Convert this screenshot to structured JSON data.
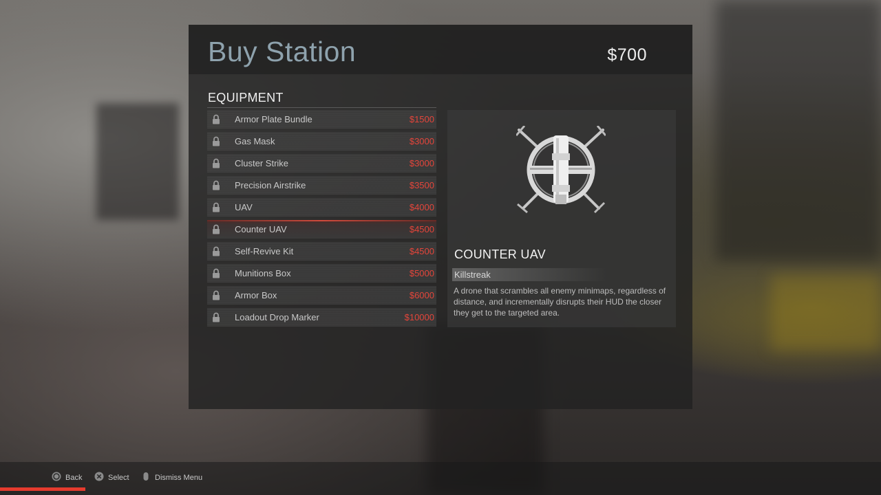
{
  "header": {
    "title": "Buy Station",
    "money": "$700"
  },
  "section": {
    "title": "EQUIPMENT"
  },
  "items": [
    {
      "name": "Armor Plate Bundle",
      "price": "$1500",
      "icon": "lock-icon"
    },
    {
      "name": "Gas Mask",
      "price": "$3000",
      "icon": "lock-icon"
    },
    {
      "name": "Cluster Strike",
      "price": "$3000",
      "icon": "lock-icon"
    },
    {
      "name": "Precision Airstrike",
      "price": "$3500",
      "icon": "lock-icon"
    },
    {
      "name": "UAV",
      "price": "$4000",
      "icon": "lock-icon"
    },
    {
      "name": "Counter UAV",
      "price": "$4500",
      "icon": "lock-icon",
      "selected": true
    },
    {
      "name": "Self-Revive Kit",
      "price": "$4500",
      "icon": "lock-icon"
    },
    {
      "name": "Munitions Box",
      "price": "$5000",
      "icon": "lock-icon"
    },
    {
      "name": "Armor Box",
      "price": "$6000",
      "icon": "lock-icon"
    },
    {
      "name": "Loadout Drop Marker",
      "price": "$10000",
      "icon": "lock-icon"
    }
  ],
  "detail": {
    "name": "COUNTER UAV",
    "category": "Killstreak",
    "description": "A drone that scrambles all enemy minimaps, regardless of distance, and incrementally disrupts their HUD the closer they get to the targeted area.",
    "icon": "counter-uav-drone-icon"
  },
  "footer": {
    "back_label": "Back",
    "select_label": "Select",
    "dismiss_label": "Dismiss Menu",
    "back_icon": "circle-button-icon",
    "select_icon": "cross-button-icon",
    "dismiss_icon": "touchpad-icon"
  },
  "colors": {
    "title": "#8ea2ad",
    "price": "#e4453a",
    "accent": "#e63b2e"
  }
}
